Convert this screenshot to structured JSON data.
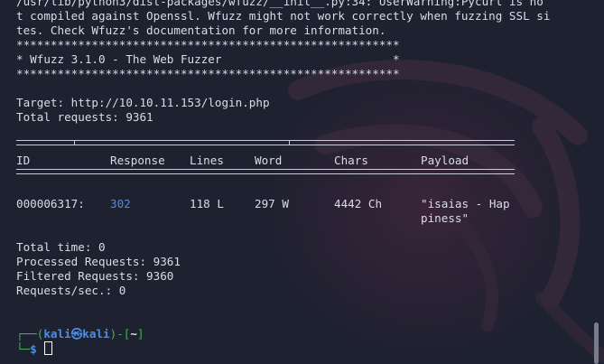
{
  "terminal": {
    "warning_lines": [
      "/usr/lib/python3/dist-packages/wfuzz/__init__.py:34: UserWarning:Pycurl is no",
      "t compiled against Openssl. Wfuzz might not work correctly when fuzzing SSL si",
      "tes. Check Wfuzz's documentation for more information."
    ],
    "banner": {
      "stars": "********************************************************",
      "title": "* Wfuzz 3.1.0 - The Web Fuzzer                         *"
    },
    "target": "Target: http://10.10.11.153/login.php",
    "total_requests": "Total requests: 9361",
    "table": {
      "headers": [
        "ID",
        "Response",
        "Lines",
        "Word",
        "Chars",
        "Payload"
      ],
      "rows": [
        {
          "id": "000006317:",
          "response": "302",
          "lines": "118 L",
          "word": "297 W",
          "chars": "4442 Ch",
          "payload_line1": "\"isaias - Hap",
          "payload_line2": "piness\""
        }
      ]
    },
    "summary": {
      "total_time": "Total time: 0",
      "processed": "Processed Requests: 9361",
      "filtered": "Filtered Requests: 9360",
      "rate": "Requests/sec.: 0"
    },
    "prompt": {
      "open": "┌──(",
      "user": "kali",
      "at": "㉿",
      "host": "kali",
      "mid": ")-[",
      "dir": "~",
      "close": "]",
      "line2_prefix": "└─",
      "dollar": "$"
    }
  },
  "colors": {
    "background": "#1e2130",
    "text": "#dadde6",
    "link": "#4a8fe7",
    "prompt_green": "#3fb24f"
  }
}
